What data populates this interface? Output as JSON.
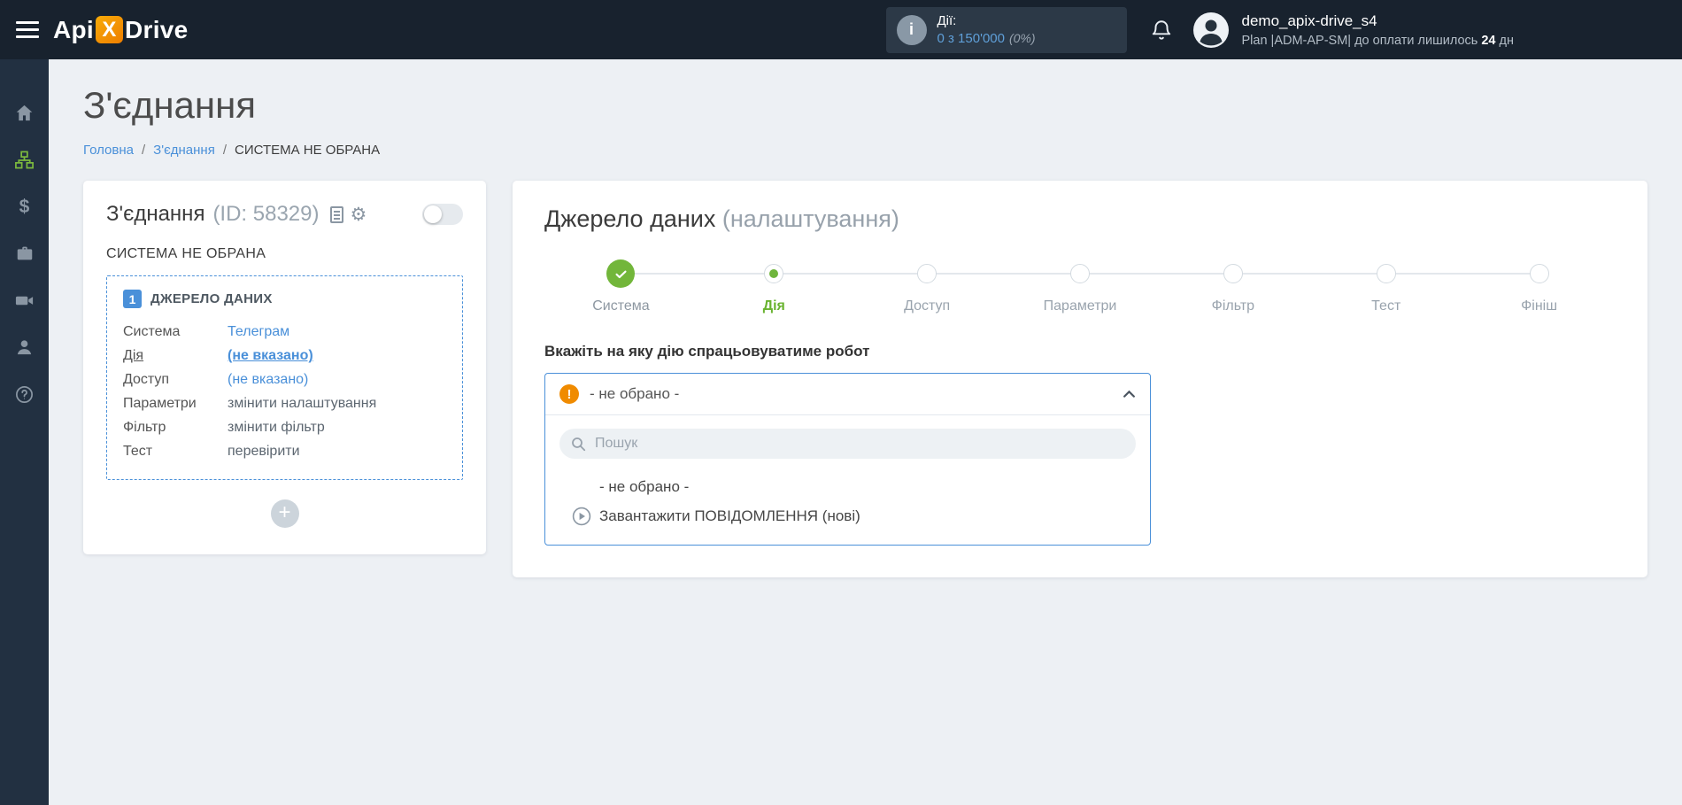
{
  "colors": {
    "accent_blue": "#4a90d9",
    "success_green": "#72b63a",
    "warning_orange": "#f08b00",
    "topbar_bg": "#18222e",
    "sidebar_bg": "#223041",
    "page_bg": "#edf0f4"
  },
  "header": {
    "logo": {
      "part1": "Api",
      "x": "X",
      "part2": "Drive"
    },
    "stats": {
      "label": "Дії:",
      "value": "0 з 150'000",
      "percent": "(0%)"
    },
    "user": {
      "name": "demo_apix-drive_s4",
      "plan_prefix": "Plan |ADM-AP-SM| до оплати лишилось",
      "plan_days": "24",
      "plan_days_suffix": "дн"
    }
  },
  "sidebar": {
    "items": [
      {
        "icon": "home-icon",
        "active": false
      },
      {
        "icon": "connections-icon",
        "active": true
      },
      {
        "icon": "payments-icon",
        "active": false
      },
      {
        "icon": "services-icon",
        "active": false
      },
      {
        "icon": "video-icon",
        "active": false
      },
      {
        "icon": "account-icon",
        "active": false
      },
      {
        "icon": "help-icon",
        "active": false
      }
    ]
  },
  "page": {
    "title": "З'єднання",
    "breadcrumb": [
      "Головна",
      "З'єднання",
      "СИСТЕМА НЕ ОБРАНА"
    ],
    "breadcrumb_separator": "/"
  },
  "connection_card": {
    "title": "З'єднання",
    "id_label": "(ID: 58329)",
    "status": "СИСТЕМА НЕ ОБРАНА",
    "source_block": {
      "badge": "1",
      "title": "ДЖЕРЕЛО ДАНИХ",
      "rows": [
        {
          "label": "Система",
          "value": "Телеграм"
        },
        {
          "label": "Дія",
          "value": "(не вказано)"
        },
        {
          "label": "Доступ",
          "value": "(не вказано)"
        },
        {
          "label": "Параметри",
          "value": "змінити налаштування"
        },
        {
          "label": "Фільтр",
          "value": "змінити фільтр"
        },
        {
          "label": "Тест",
          "value": "перевірити"
        }
      ]
    },
    "add_button": "+"
  },
  "settings_card": {
    "title": "Джерело даних",
    "title_suffix": "(налаштування)",
    "steps": [
      {
        "label": "Система",
        "state": "done"
      },
      {
        "label": "Дія",
        "state": "active"
      },
      {
        "label": "Доступ",
        "state": "pending"
      },
      {
        "label": "Параметри",
        "state": "pending"
      },
      {
        "label": "Фільтр",
        "state": "pending"
      },
      {
        "label": "Тест",
        "state": "pending"
      },
      {
        "label": "Фініш",
        "state": "pending"
      }
    ],
    "question": "Вкажіть на яку дію спрацьовуватиме робот",
    "dropdown": {
      "selected": "- не обрано -",
      "warning_glyph": "!",
      "search_placeholder": "Пошук",
      "options": [
        {
          "label": "- не обрано -",
          "icon": "none"
        },
        {
          "label": "Завантажити ПОВІДОМЛЕННЯ (нові)",
          "icon": "play-circle-icon"
        }
      ]
    }
  }
}
